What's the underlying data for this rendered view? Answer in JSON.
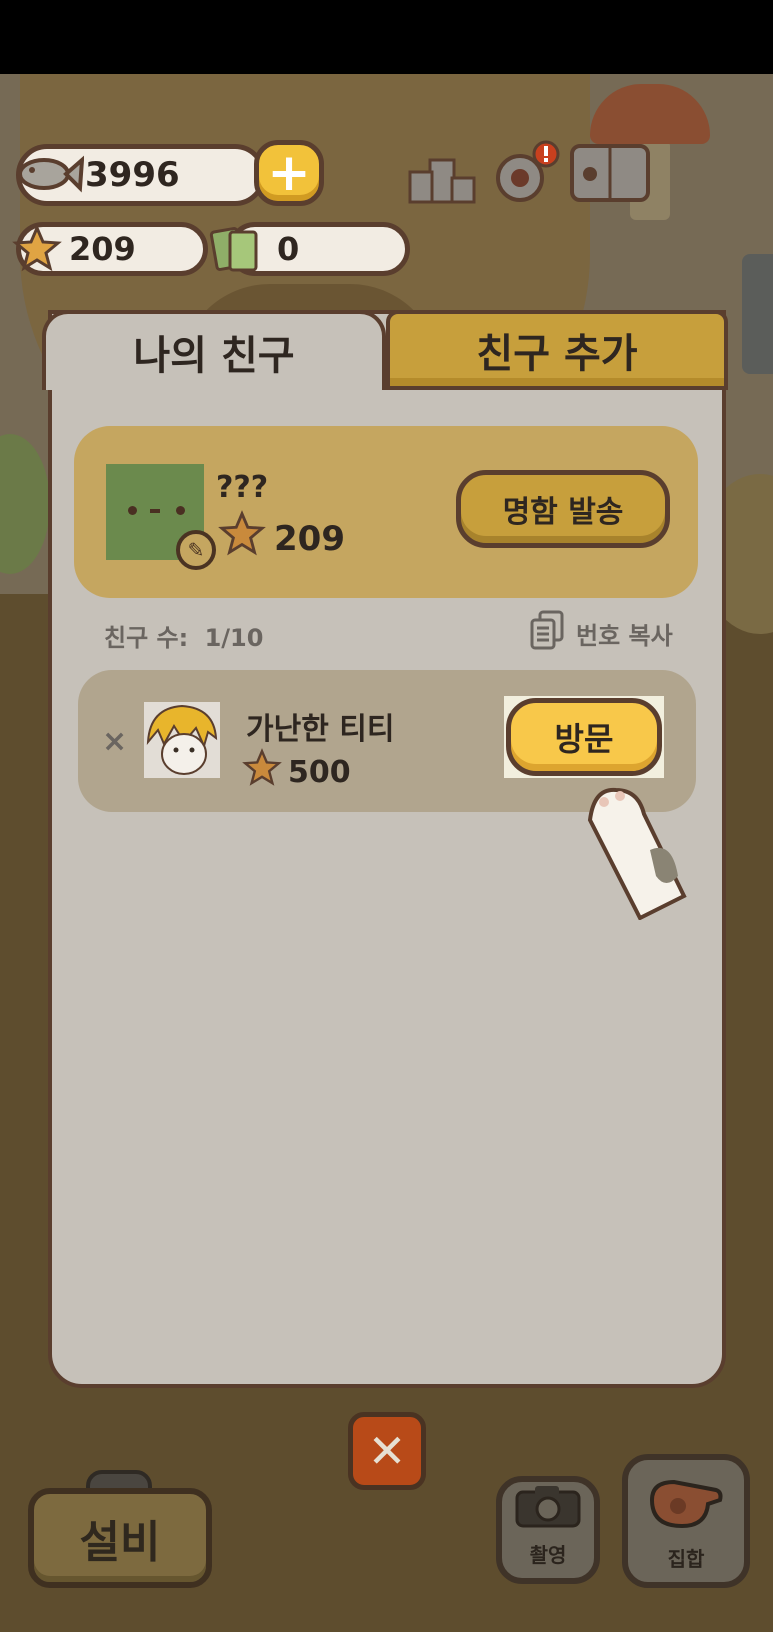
{
  "hud": {
    "fish_count": "3996",
    "star_count": "209",
    "ticket_count": "0",
    "plus_label": "+"
  },
  "tabs": {
    "my_friends": "나의 친구",
    "add_friend": "친구 추가"
  },
  "profile": {
    "name": "???",
    "stars": "209",
    "send_card_label": "명함 발송"
  },
  "friends_meta": {
    "count_label": "친구 수:",
    "count_value": "1/10",
    "copy_number_label": "번호 복사"
  },
  "friends": [
    {
      "name": "가난한 티티",
      "stars": "500",
      "visit_label": "방문",
      "remove_label": "×"
    }
  ],
  "bottom": {
    "close_label": "✕",
    "equip_label": "설비",
    "camera_label": "촬영",
    "gather_label": "집합"
  },
  "colors": {
    "accent_yellow": "#f8c84a",
    "tab_gold": "#c79f3c",
    "panel_bg": "#c6c1b9",
    "border_brown": "#5a3e2e",
    "close_red": "#b84a18"
  },
  "icons": [
    "fish-icon",
    "plus-icon",
    "star-icon",
    "ticket-icon",
    "ranking-icon",
    "gear-icon",
    "paw-book-icon",
    "edit-icon",
    "copy-icon",
    "close-icon",
    "camera-icon",
    "whistle-icon"
  ]
}
